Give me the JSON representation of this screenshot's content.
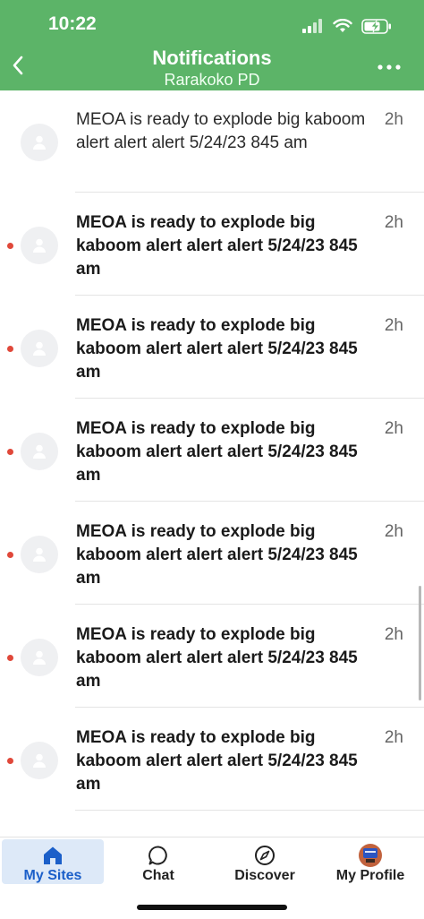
{
  "status_bar": {
    "time": "10:22"
  },
  "header": {
    "title": "Notifications",
    "subtitle": "Rarakoko PD"
  },
  "notifications": [
    {
      "message": "MEOA is ready to explode big kaboom alert alert alert 5/24/23 845 am",
      "time": "2h",
      "unread": false
    },
    {
      "message": "MEOA is ready to explode big kaboom alert alert alert 5/24/23 845 am",
      "time": "2h",
      "unread": true
    },
    {
      "message": "MEOA is ready to explode big kaboom alert alert alert 5/24/23 845 am",
      "time": "2h",
      "unread": true
    },
    {
      "message": "MEOA is ready to explode big kaboom alert alert alert 5/24/23 845 am",
      "time": "2h",
      "unread": true
    },
    {
      "message": "MEOA is ready to explode big kaboom alert alert alert 5/24/23 845 am",
      "time": "2h",
      "unread": true
    },
    {
      "message": "MEOA is ready to explode big kaboom alert alert alert 5/24/23 845 am",
      "time": "2h",
      "unread": true
    },
    {
      "message": "MEOA is ready to explode big kaboom alert alert alert 5/24/23 845 am",
      "time": "2h",
      "unread": true
    }
  ],
  "bottom_nav": {
    "items": [
      {
        "label": "My Sites",
        "icon": "home-icon",
        "active": true
      },
      {
        "label": "Chat",
        "icon": "chat-bubble-icon",
        "active": false
      },
      {
        "label": "Discover",
        "icon": "compass-icon",
        "active": false
      },
      {
        "label": "My Profile",
        "icon": "profile-avatar-icon",
        "active": false
      }
    ]
  },
  "colors": {
    "header_bg": "#5cb468",
    "unread_dot": "#e0483a",
    "active_nav": "#1b5fc9"
  }
}
